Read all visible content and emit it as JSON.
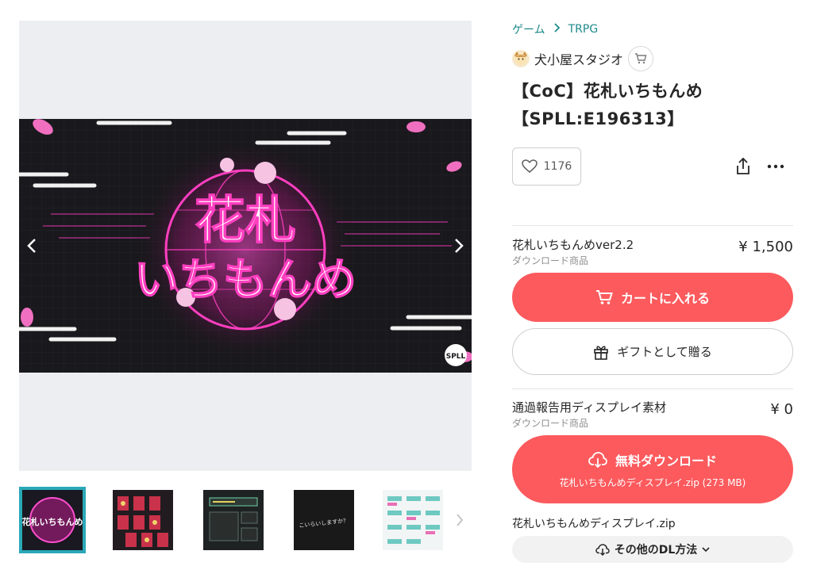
{
  "breadcrumb": {
    "category": "ゲーム",
    "subcategory": "TRPG"
  },
  "shop": {
    "name": "犬小屋スタジオ"
  },
  "product": {
    "title": "【CoC】花札いちもんめ【SPLL:E196313】"
  },
  "likes": {
    "count": "1176"
  },
  "main_image": {
    "title_line1": "花札",
    "title_line2": "いちもんめ",
    "badge": "SPLL"
  },
  "thumbnails": {
    "items": [
      {
        "label": "花札いちもんめ"
      },
      {
        "label": ""
      },
      {
        "label": ""
      },
      {
        "label": "こいらいしますか？"
      },
      {
        "label": ""
      }
    ]
  },
  "variation1": {
    "name": "花札いちもんめver2.2",
    "type": "ダウンロード商品",
    "price": "¥ 1,500"
  },
  "buttons": {
    "cart": "カートに入れる",
    "gift": "ギフトとして贈る",
    "free_download": "無料ダウンロード",
    "free_download_file": "花札いちもんめディスプレイ.zip (273 MB)",
    "other_dl": "その他のDL方法"
  },
  "variation2": {
    "name": "通過報告用ディスプレイ素材",
    "type": "ダウンロード商品",
    "price": "¥ 0"
  },
  "file": {
    "name": "花札いちもんめディスプレイ.zip"
  },
  "colors": {
    "accent": "#fc4d50",
    "link": "#1f8a8c",
    "thumb_border": "#2aa8b8",
    "magenta": "#e23aa8"
  }
}
